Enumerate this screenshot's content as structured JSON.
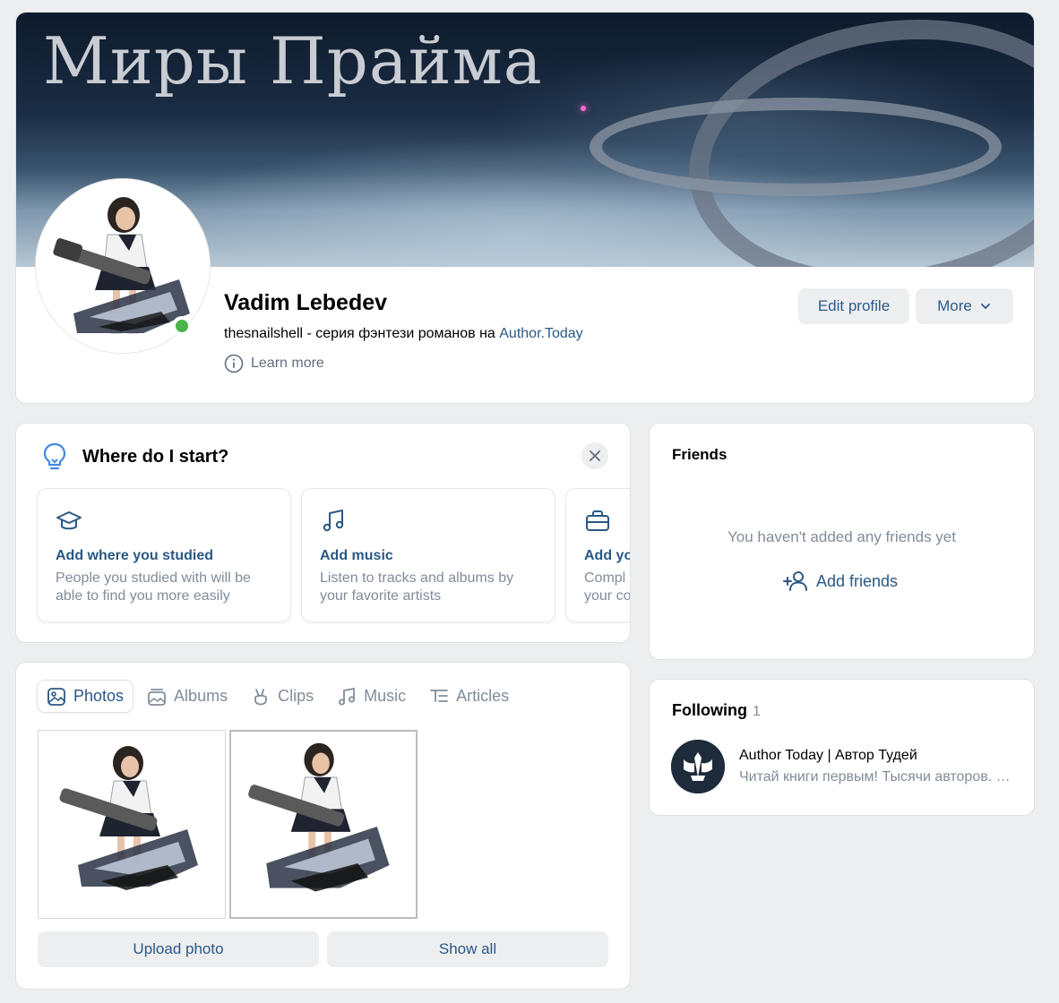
{
  "cover": {
    "title": "Миры Прайма"
  },
  "profile": {
    "name": "Vadim Lebedev",
    "status_prefix": "thesnailshell - серия фэнтези романов на ",
    "status_link": "Author.Today",
    "learn_more": "Learn more",
    "online": true,
    "edit_profile_label": "Edit profile",
    "more_label": "More"
  },
  "start": {
    "title": "Where do I start?",
    "tips": [
      {
        "icon": "graduation-cap-icon",
        "title": "Add where you studied",
        "desc": "People you studied with will be able to find you more easily"
      },
      {
        "icon": "music-note-icon",
        "title": "Add music",
        "desc": "Listen to tracks and albums by your favorite artists"
      },
      {
        "icon": "briefcase-icon",
        "title": "Add yo",
        "desc": "Compl your co"
      }
    ]
  },
  "friends": {
    "title": "Friends",
    "empty_text": "You haven't added any friends yet",
    "add_label": "Add friends"
  },
  "following": {
    "title": "Following",
    "count": "1",
    "items": [
      {
        "name": "Author Today | Автор Тудей",
        "desc": "Читай книги первым! Тысячи авторов. Сотни"
      }
    ]
  },
  "media": {
    "tabs": [
      {
        "label": "Photos",
        "icon": "photo-icon",
        "active": true
      },
      {
        "label": "Albums",
        "icon": "albums-icon",
        "active": false
      },
      {
        "label": "Clips",
        "icon": "clips-icon",
        "active": false
      },
      {
        "label": "Music",
        "icon": "music-icon",
        "active": false
      },
      {
        "label": "Articles",
        "icon": "articles-icon",
        "active": false
      }
    ],
    "upload_label": "Upload photo",
    "show_all_label": "Show all"
  },
  "colors": {
    "accent": "#2a5885",
    "online": "#4bb34b",
    "background": "#edeef0"
  }
}
